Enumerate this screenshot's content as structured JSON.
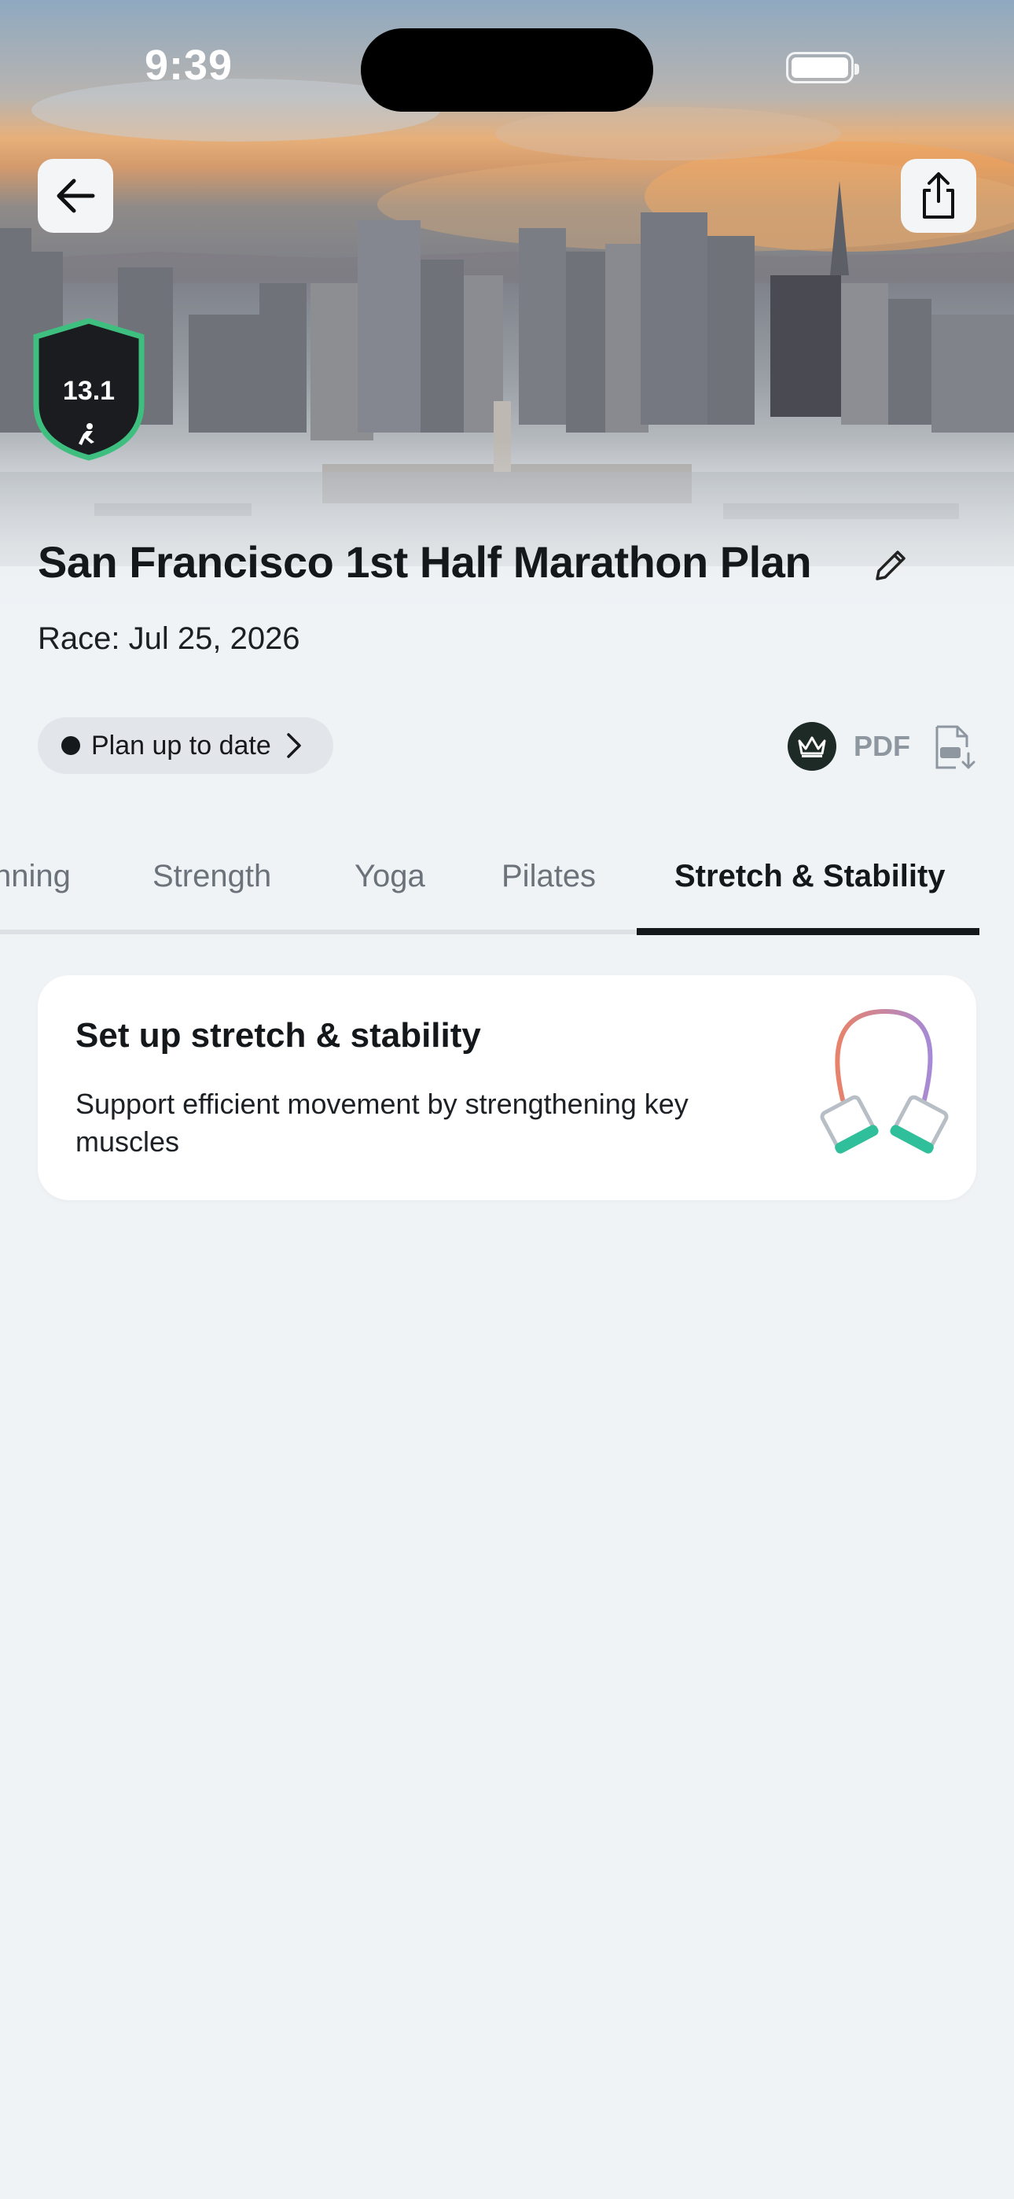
{
  "status_bar": {
    "time": "9:39"
  },
  "header": {
    "back_icon": "arrow-left-icon",
    "share_icon": "share-icon",
    "badge_distance": "13.1",
    "title": "San Francisco 1st Half Marathon Plan",
    "race_date": "Race: Jul 25, 2026"
  },
  "plan_status": {
    "label": "Plan up to date",
    "pdf_label": "PDF"
  },
  "tabs": [
    {
      "label": "nning",
      "active": false
    },
    {
      "label": "Strength",
      "active": false
    },
    {
      "label": "Yoga",
      "active": false
    },
    {
      "label": "Pilates",
      "active": false
    },
    {
      "label": "Stretch & Stability",
      "active": true
    }
  ],
  "card": {
    "title": "Set up stretch & stability",
    "description": "Support efficient movement by strengthening key muscles"
  },
  "colors": {
    "background": "#eff3f6",
    "badge_border": "#3fbf7f",
    "badge_fill": "#1a1c1f",
    "band_handle": "#2fbf9a"
  }
}
